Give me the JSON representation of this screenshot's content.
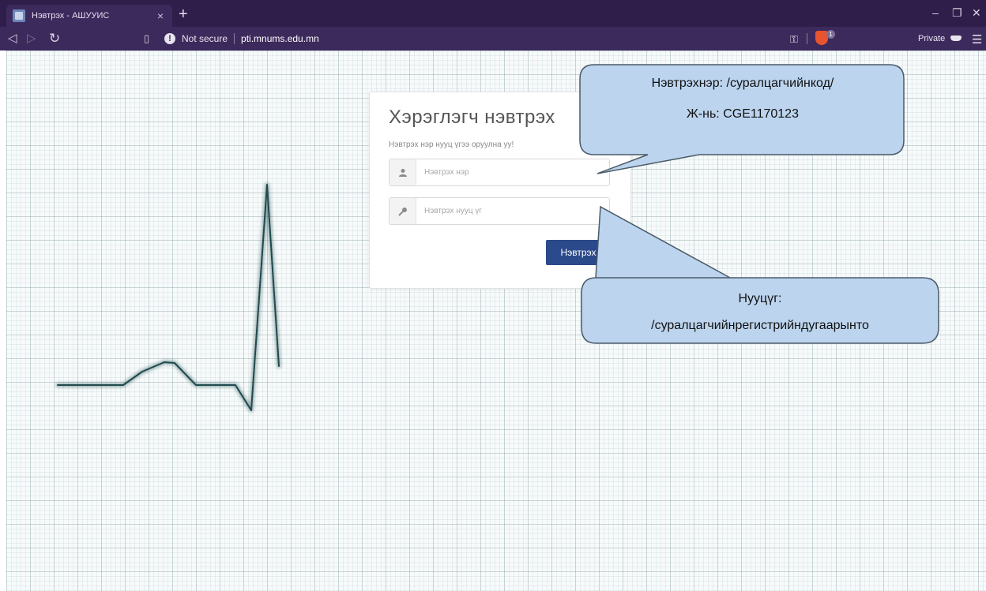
{
  "browser": {
    "tab": {
      "title": "Нэвтрэх - АШУУИС"
    },
    "address": {
      "security": "Not secure",
      "url": "pti.mnums.edu.mn"
    },
    "shield_badge": "1",
    "private_label": "Private"
  },
  "icons": {
    "back": "back-arrow-icon",
    "forward": "forward-arrow-icon",
    "reload": "reload-icon",
    "bookmark": "bookmark-icon",
    "warning": "warning-icon",
    "key": "key-icon",
    "shield": "brave-shield-icon",
    "private": "private-mask-icon",
    "menu": "hamburger-menu-icon",
    "user": "user-icon",
    "lock": "key-icon"
  },
  "login": {
    "title": "Хэрэглэгч нэвтрэх",
    "subtitle": "Нэвтрэх нэр нууц үгээ оруулна уу!",
    "username_placeholder": "Нэвтрэх нэр",
    "password_placeholder": "Нэвтрэх нууц үг",
    "submit_label": "Нэвтрэх"
  },
  "callouts": {
    "username_line1": "Нэвтрэхнэр: /суралцагчийнкод/",
    "username_line2": "Ж-нь: CGE1170123",
    "password_line1": "Нууцүг:",
    "password_line2": "/суралцагчийнрегистрийндугаарынто"
  },
  "colors": {
    "chrome": "#2f1e4a",
    "toolbar": "#3d2a5c",
    "button": "#2b4a8b",
    "callout_fill": "#bcd4ee",
    "callout_stroke": "#4a5a68",
    "ecg_trace": "#1f4a4e"
  }
}
